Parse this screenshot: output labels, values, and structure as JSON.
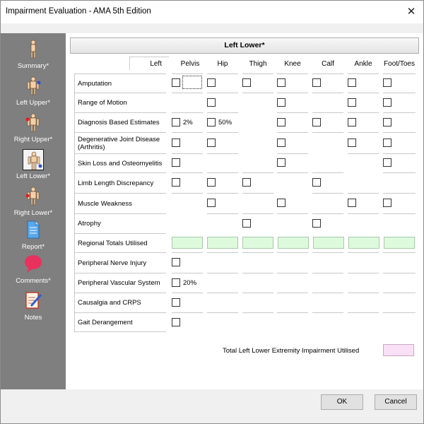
{
  "window": {
    "title": "Impairment Evaluation - AMA 5th Edition",
    "close_glyph": "✕"
  },
  "sidebar": {
    "items": [
      {
        "label": "Summary*",
        "icon": "summary-body-icon"
      },
      {
        "label": "Left Upper*",
        "icon": "left-upper-body-icon"
      },
      {
        "label": "Right Upper*",
        "icon": "right-upper-body-icon"
      },
      {
        "label": "Left Lower*",
        "icon": "left-lower-body-icon",
        "selected": true
      },
      {
        "label": "Right Lower*",
        "icon": "right-lower-body-icon"
      },
      {
        "label": "Report*",
        "icon": "report-document-icon"
      },
      {
        "label": "Comments*",
        "icon": "speech-bubble-icon"
      },
      {
        "label": "Notes",
        "icon": "notes-pencil-icon"
      }
    ]
  },
  "panel": {
    "title": "Left Lower*",
    "side_label": "Left",
    "columns": [
      "Pelvis",
      "Hip",
      "Thigh",
      "Knee",
      "Calf",
      "Ankle",
      "Foot/Toes"
    ],
    "rows": [
      {
        "label": "Amputation"
      },
      {
        "label": "Range of Motion"
      },
      {
        "label": "Diagnosis Based Estimates"
      },
      {
        "label": "Degenerative Joint Disease (Arthritis)"
      },
      {
        "label": "Skin Loss and Osteomyelitis"
      },
      {
        "label": "Limb Length Discrepancy"
      },
      {
        "label": "Muscle Weakness"
      },
      {
        "label": "Atrophy"
      },
      {
        "label": "Regional Totals Utilised"
      },
      {
        "label": "Peripheral Nerve Injury"
      },
      {
        "label": "Peripheral Vascular System"
      },
      {
        "label": "Causalgia and CRPS"
      },
      {
        "label": "Gait Derangement"
      }
    ],
    "values": {
      "dbe_pelvis": "2%",
      "dbe_hip": "50%",
      "vascular": "20%"
    },
    "total_label": "Total Left Lower Extremity Impairment Utilised"
  },
  "footer": {
    "ok_label": "OK",
    "cancel_label": "Cancel"
  },
  "colors": {
    "sidebar": "#7f7f7f",
    "totals_fill": "#ddfadd",
    "grand_total_fill": "#fae0f7"
  }
}
